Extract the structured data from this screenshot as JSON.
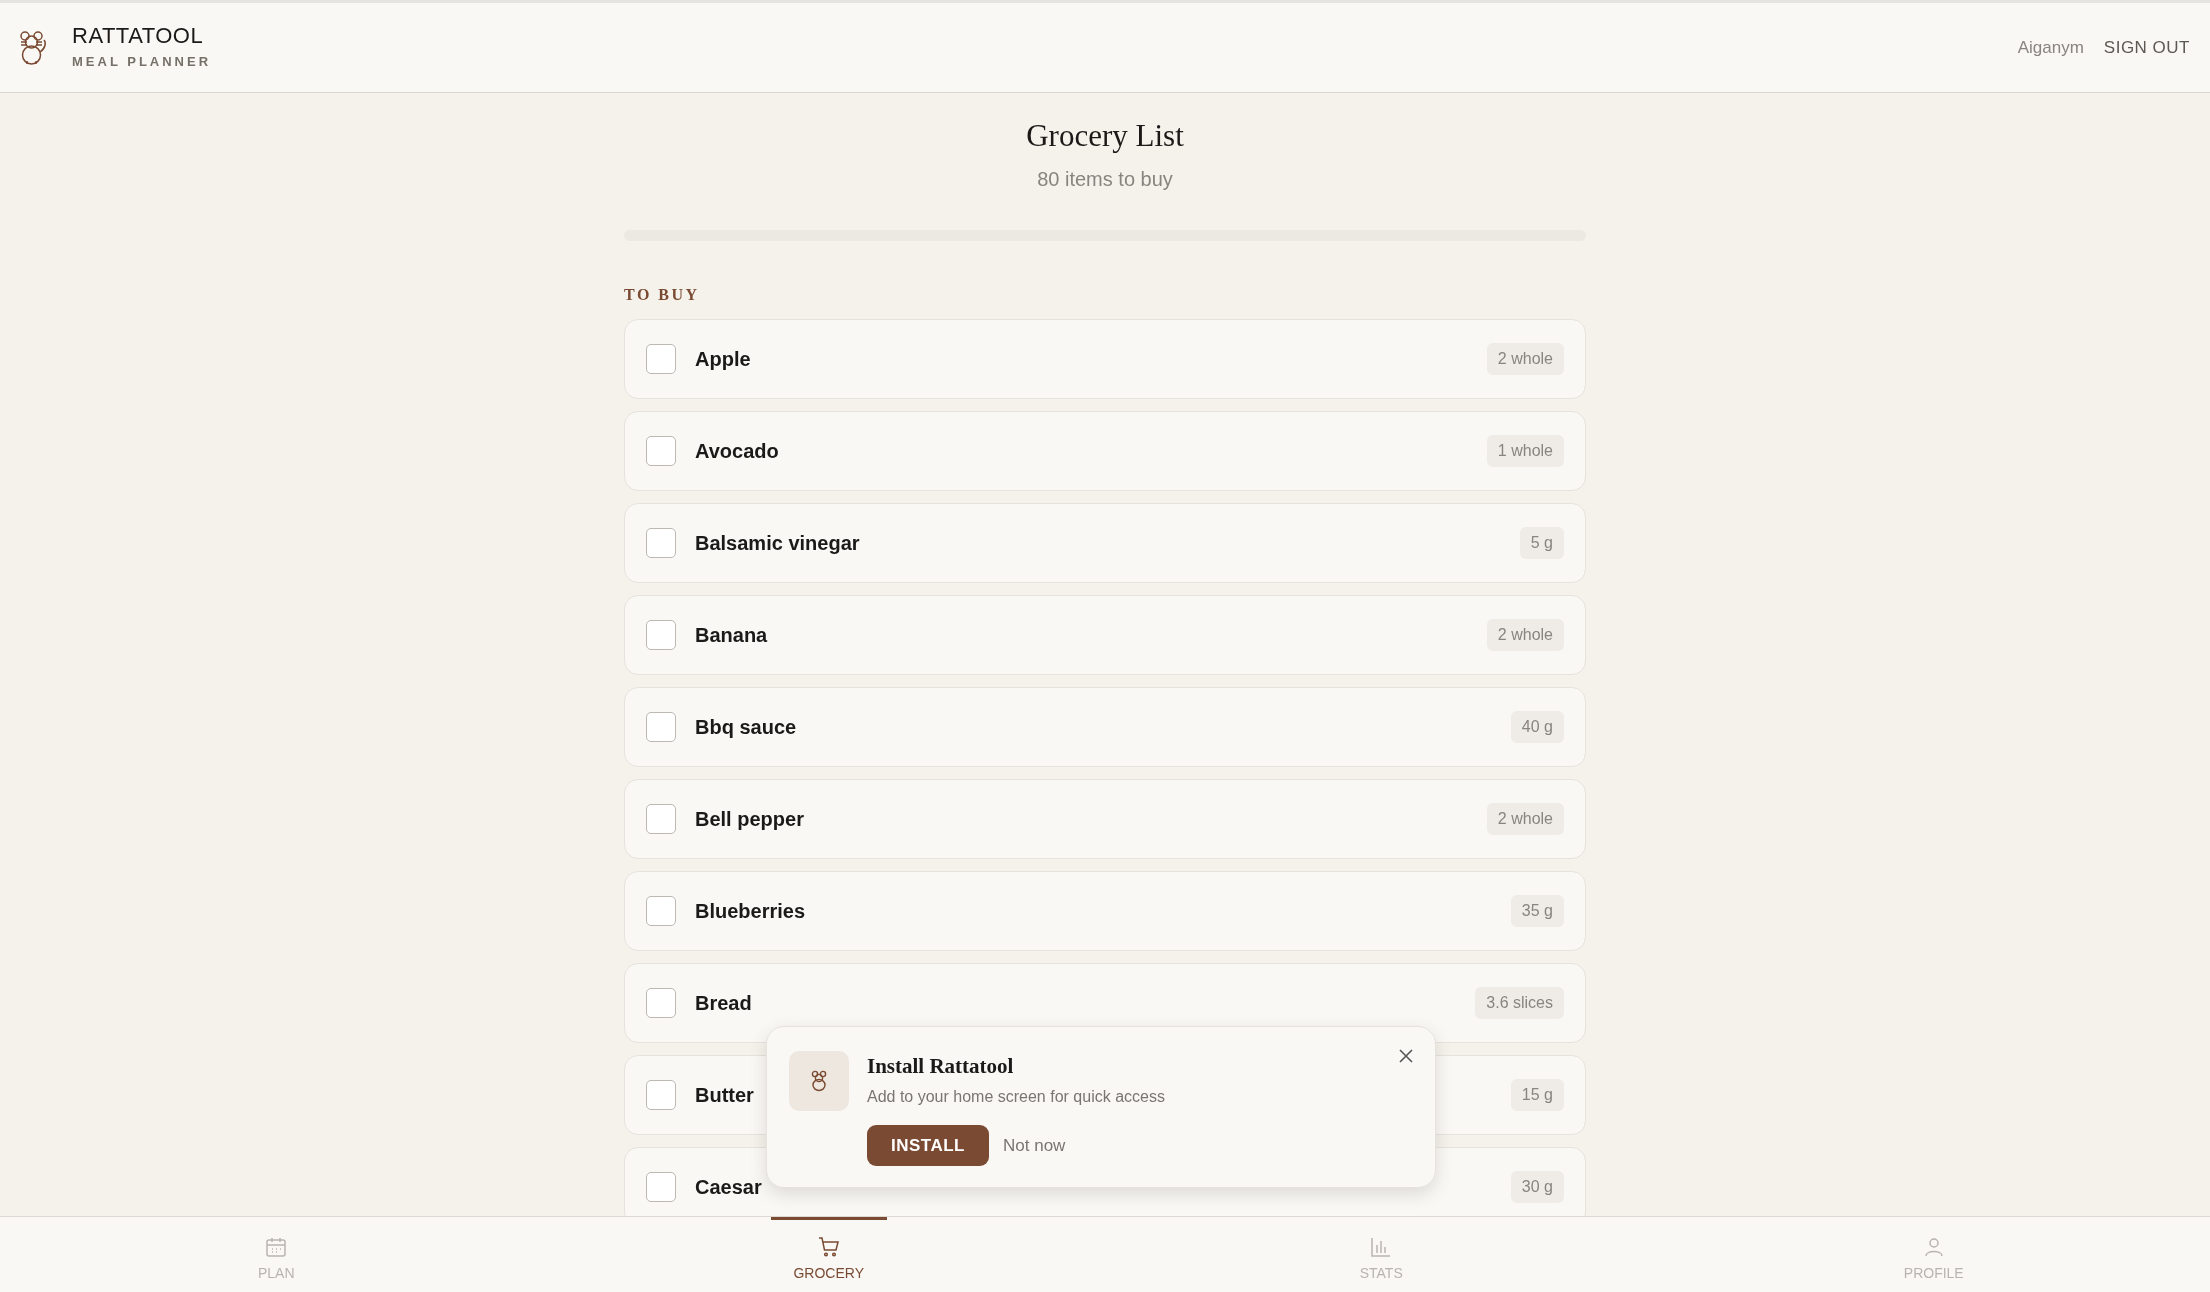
{
  "header": {
    "title": "RATTATOOL",
    "subtitle": "MEAL PLANNER",
    "user": "Aiganym",
    "sign_out": "SIGN OUT"
  },
  "page": {
    "title": "Grocery List",
    "subtitle": "80 items to buy",
    "progress": {
      "level": 0
    }
  },
  "section": {
    "title": "TO BUY"
  },
  "items": [
    {
      "name": "Apple",
      "quantity": "2 whole",
      "checked": false
    },
    {
      "name": "Avocado",
      "quantity": "1 whole",
      "checked": false
    },
    {
      "name": "Balsamic vinegar",
      "quantity": "5 g",
      "checked": false
    },
    {
      "name": "Banana",
      "quantity": "2 whole",
      "checked": false
    },
    {
      "name": "Bbq sauce",
      "quantity": "40 g",
      "checked": false
    },
    {
      "name": "Bell pepper",
      "quantity": "2 whole",
      "checked": false
    },
    {
      "name": "Blueberries",
      "quantity": "35 g",
      "checked": false
    },
    {
      "name": "Bread",
      "quantity": "3.6 slices",
      "checked": false
    },
    {
      "name": "Butter",
      "quantity": "15 g",
      "checked": false
    },
    {
      "name": "Caesar",
      "quantity": "30 g",
      "checked": false
    }
  ],
  "install_prompt": {
    "title": "Install Rattatool",
    "text": "Add to your home screen for quick access",
    "install": "INSTALL",
    "dismiss": "Not now"
  },
  "bottom_nav": [
    {
      "kind": "plan",
      "label": "PLAN",
      "selected": false
    },
    {
      "kind": "grocery",
      "label": "GROCERY",
      "selected": true
    },
    {
      "kind": "stats",
      "label": "STATS",
      "selected": false
    },
    {
      "kind": "profile",
      "label": "PROFILE",
      "selected": false
    }
  ]
}
